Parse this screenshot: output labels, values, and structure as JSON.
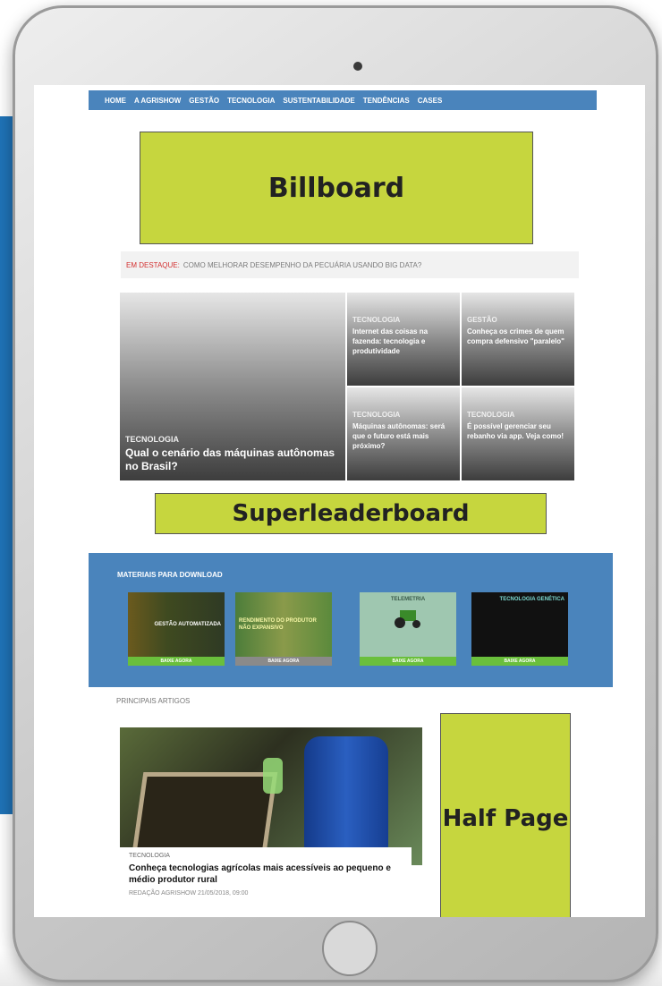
{
  "nav": {
    "items": [
      "HOME",
      "A AGRISHOW",
      "GESTÃO",
      "TECNOLOGIA",
      "SUSTENTABILIDADE",
      "TENDÊNCIAS",
      "CASES"
    ]
  },
  "ads": {
    "billboard": "Billboard",
    "superleaderboard": "Superleaderboard",
    "half_page": "Half Page"
  },
  "highlight": {
    "label": "EM DESTAQUE:",
    "text": "COMO MELHORAR DESEMPENHO DA PECUÁRIA USANDO BIG DATA?"
  },
  "featured": {
    "main": {
      "category": "TECNOLOGIA",
      "title": "Qual o cenário das máquinas autônomas no Brasil?"
    },
    "tiles": [
      {
        "category": "TECNOLOGIA",
        "title": "Internet das coisas na fazenda: tecnologia e produtividade"
      },
      {
        "category": "GESTÃO",
        "title": "Conheça os crimes de quem compra defensivo \"paralelo\""
      },
      {
        "category": "TECNOLOGIA",
        "title": "Máquinas autônomas: será que o futuro está mais próximo?"
      },
      {
        "category": "TECNOLOGIA",
        "title": "É possível gerenciar seu rebanho via app. Veja como!"
      }
    ]
  },
  "downloads": {
    "title": "MATERIAIS PARA DOWNLOAD",
    "items": [
      {
        "image_text": "GESTÃO AUTOMATIZADA",
        "button": "BAIXE AGORA"
      },
      {
        "image_text": "RENDIMENTO DO PRODUTOR NÃO EXPANSIVO",
        "button": "BAIXE AGORA"
      },
      {
        "image_text": "TELEMETRIA",
        "button": "BAIXE AGORA"
      },
      {
        "image_text": "TECNOLOGIA GENÉTICA",
        "button": "BAIXE AGORA"
      }
    ]
  },
  "articles": {
    "title": "PRINCIPAIS ARTIGOS",
    "main": {
      "category": "TECNOLOGIA",
      "title": "Conheça tecnologias agrícolas mais acessíveis ao pequeno e médio produtor rural",
      "meta": "REDAÇÃO AGRISHOW 21/05/2018, 09:00"
    }
  }
}
